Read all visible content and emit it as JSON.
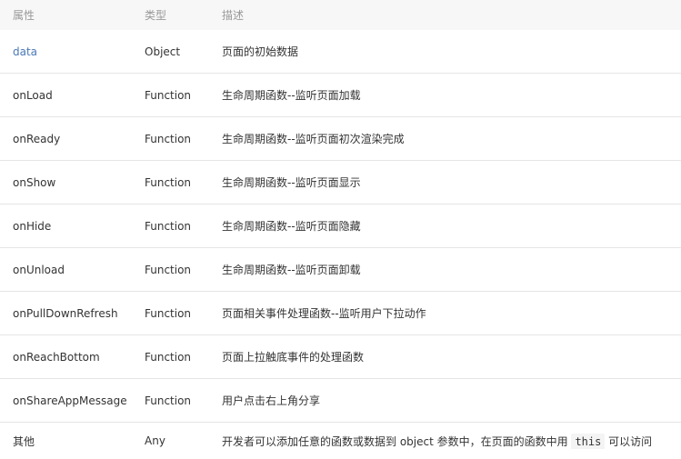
{
  "header": {
    "col_name": "属性",
    "col_type": "类型",
    "col_desc": "描述"
  },
  "rows": [
    {
      "name": "data",
      "type": "Object",
      "desc": "页面的初始数据"
    },
    {
      "name": "onLoad",
      "type": "Function",
      "desc": "生命周期函数--监听页面加载"
    },
    {
      "name": "onReady",
      "type": "Function",
      "desc": "生命周期函数--监听页面初次渲染完成"
    },
    {
      "name": "onShow",
      "type": "Function",
      "desc": "生命周期函数--监听页面显示"
    },
    {
      "name": "onHide",
      "type": "Function",
      "desc": "生命周期函数--监听页面隐藏"
    },
    {
      "name": "onUnload",
      "type": "Function",
      "desc": "生命周期函数--监听页面卸载"
    },
    {
      "name": "onPullDownRefresh",
      "type": "Function",
      "desc": "页面相关事件处理函数--监听用户下拉动作"
    },
    {
      "name": "onReachBottom",
      "type": "Function",
      "desc": "页面上拉触底事件的处理函数"
    },
    {
      "name": "onShareAppMessage",
      "type": "Function",
      "desc": "用户点击右上角分享"
    },
    {
      "name": "其他",
      "type": "Any",
      "desc_pre": "开发者可以添加任意的函数或数据到 object 参数中，在页面的函数中用 ",
      "desc_code": "this",
      "desc_post": " 可以访问"
    }
  ],
  "colors": {
    "link": "#4a78b6",
    "header_bg": "#f7f7f7",
    "header_text": "#999999",
    "border": "#e5e5e5"
  }
}
